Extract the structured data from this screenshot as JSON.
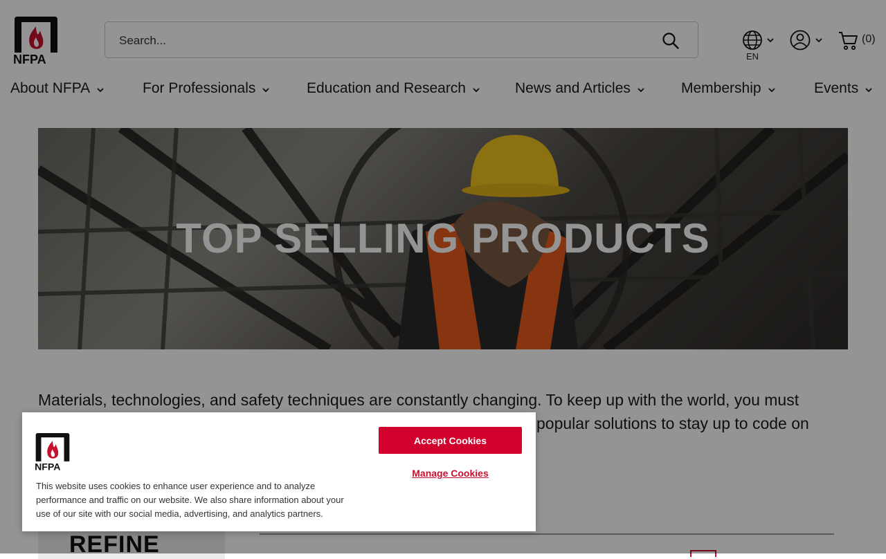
{
  "header": {
    "logo_text": "NFPA",
    "search": {
      "placeholder": "Search...",
      "value": ""
    },
    "language": {
      "code": "EN"
    },
    "cart": {
      "count": "(0)"
    }
  },
  "nav": {
    "items": [
      {
        "label": "About NFPA"
      },
      {
        "label": "For Professionals"
      },
      {
        "label": "Education and Research"
      },
      {
        "label": "News and Articles"
      },
      {
        "label": "Membership"
      },
      {
        "label": "Events"
      }
    ]
  },
  "hero": {
    "title": "TOP SELLING PRODUCTS"
  },
  "intro": {
    "line1": "Materials, technologies, and safety techniques are constantly changing. To keep up with the world, you must",
    "line2_tail": "popular solutions to stay up to code on"
  },
  "sidebar": {
    "refine_label": "REFINE"
  },
  "cookie_banner": {
    "logo_text": "NFPA",
    "text": "This website uses cookies to enhance user experience and to analyze performance and traffic on our website. We also share information about your use of our site with our social media, advertising, and analytics partners.",
    "accept_label": "Accept Cookies",
    "manage_label": "Manage Cookies"
  },
  "colors": {
    "brand_red": "#c8102e",
    "accept_button": "#d1002d",
    "overlay": "rgba(0,0,0,0.42)"
  }
}
